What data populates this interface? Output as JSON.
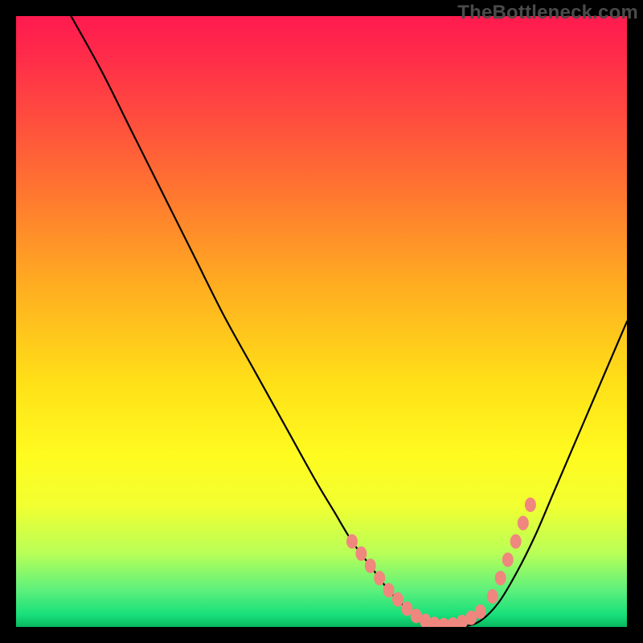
{
  "watermark": "TheBottleneck.com",
  "chart_data": {
    "type": "line",
    "title": "",
    "xlabel": "",
    "ylabel": "",
    "xlim": [
      0,
      100
    ],
    "ylim": [
      0,
      100
    ],
    "legend": false,
    "grid": false,
    "annotations": [],
    "series": [
      {
        "name": "bottleneck-curve",
        "x": [
          9,
          14,
          19,
          24,
          29,
          34,
          39,
          44,
          49,
          52,
          55,
          58,
          61,
          64,
          67,
          70,
          73,
          76,
          79,
          82,
          85,
          88,
          91,
          94,
          97,
          100
        ],
        "y": [
          100,
          91,
          81,
          71,
          61,
          51,
          42,
          33,
          24,
          19,
          14,
          10,
          6,
          3,
          1,
          0,
          0,
          1,
          4,
          9,
          15,
          22,
          29,
          36,
          43,
          50
        ]
      }
    ],
    "markers": {
      "comment": "highlighted salmon dots along the low portion of the curve",
      "left_arm": [
        {
          "x": 55,
          "y": 14
        },
        {
          "x": 56.5,
          "y": 12
        },
        {
          "x": 58,
          "y": 10
        },
        {
          "x": 59.5,
          "y": 8
        },
        {
          "x": 61,
          "y": 6
        },
        {
          "x": 62.5,
          "y": 4.5
        },
        {
          "x": 64,
          "y": 3
        }
      ],
      "bottom": [
        {
          "x": 65.5,
          "y": 1.8
        },
        {
          "x": 67,
          "y": 1
        },
        {
          "x": 68.5,
          "y": 0.5
        },
        {
          "x": 70,
          "y": 0.3
        },
        {
          "x": 71.5,
          "y": 0.4
        },
        {
          "x": 73,
          "y": 0.8
        },
        {
          "x": 74.5,
          "y": 1.5
        },
        {
          "x": 76,
          "y": 2.5
        }
      ],
      "right_arm": [
        {
          "x": 78,
          "y": 5
        },
        {
          "x": 79.3,
          "y": 8
        },
        {
          "x": 80.5,
          "y": 11
        },
        {
          "x": 81.8,
          "y": 14
        },
        {
          "x": 83,
          "y": 17
        },
        {
          "x": 84.2,
          "y": 20
        }
      ]
    },
    "background_gradient": {
      "direction": "top-to-bottom",
      "stops": [
        {
          "pos": 0,
          "color": "#ff1a4f"
        },
        {
          "pos": 0.35,
          "color": "#ff8a2a"
        },
        {
          "pos": 0.65,
          "color": "#ffe018"
        },
        {
          "pos": 0.9,
          "color": "#88f560"
        },
        {
          "pos": 1,
          "color": "#09b85e"
        }
      ]
    }
  }
}
